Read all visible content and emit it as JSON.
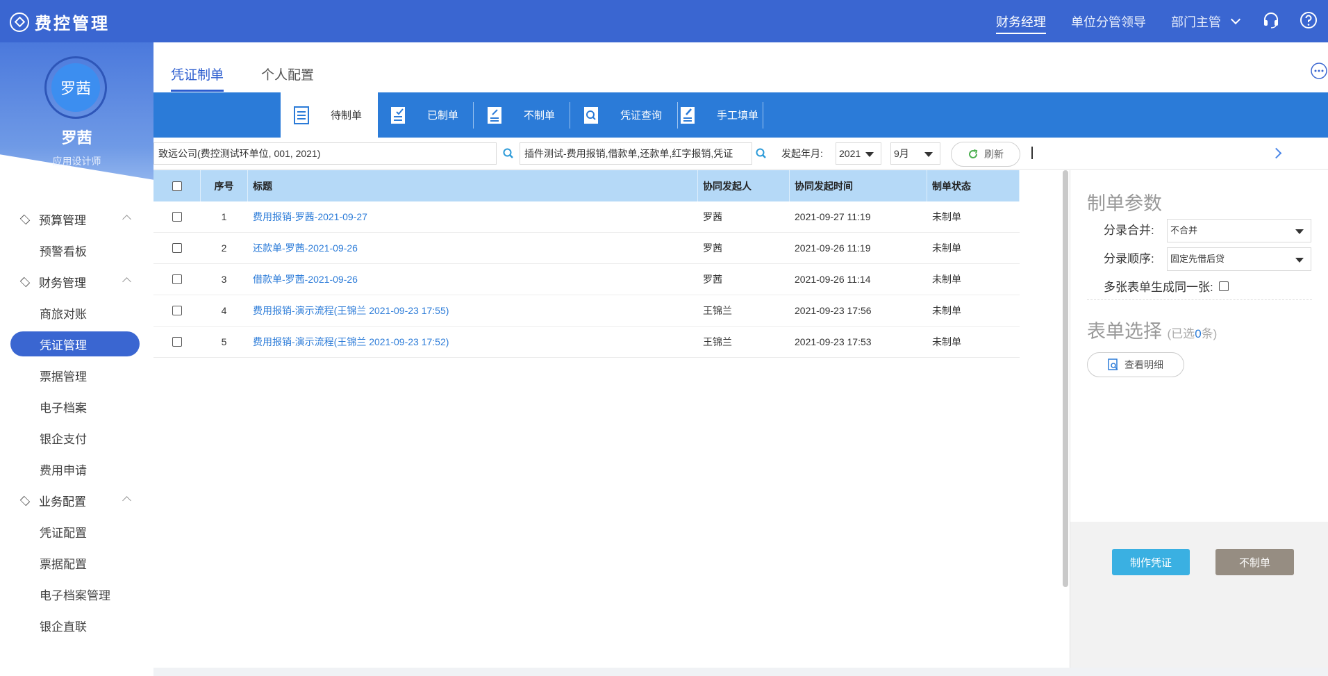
{
  "app": {
    "title": "费控管理"
  },
  "header": {
    "roles": [
      {
        "label": "财务经理",
        "active": true
      },
      {
        "label": "单位分管领导",
        "active": false
      },
      {
        "label": "部门主管",
        "active": false
      }
    ]
  },
  "profile": {
    "avatar_text": "罗茜",
    "name": "罗茜",
    "role": "应用设计师"
  },
  "sidebar": {
    "groups": [
      {
        "label": "预算管理",
        "items": [
          "预警看板"
        ]
      },
      {
        "label": "财务管理",
        "items": [
          "商旅对账",
          "凭证管理",
          "票据管理",
          "电子档案",
          "银企支付",
          "费用申请"
        ]
      },
      {
        "label": "业务配置",
        "items": [
          "凭证配置",
          "票据配置",
          "电子档案管理",
          "银企直联"
        ]
      }
    ],
    "active_item": "凭证管理"
  },
  "tabs": [
    {
      "label": "凭证制单",
      "active": true
    },
    {
      "label": "个人配置",
      "active": false
    }
  ],
  "toolbar": {
    "buttons": [
      "待制单",
      "已制单",
      "不制单",
      "凭证查询",
      "手工填单"
    ],
    "active": "待制单"
  },
  "filters": {
    "company": "致远公司(费控测试环单位, 001, 2021)",
    "templates": "插件测试-费用报销,借款单,还款单,红字报销,凭证",
    "year_month_label": "发起年月:",
    "year": "2021",
    "month": "9月",
    "refresh_label": "刷新"
  },
  "table": {
    "headers": [
      "序号",
      "标题",
      "协同发起人",
      "协同发起时间",
      "制单状态"
    ],
    "rows": [
      {
        "index": "1",
        "title": "费用报销-罗茜-2021-09-27",
        "initiator": "罗茜",
        "time": "2021-09-27 11:19",
        "status": "未制单"
      },
      {
        "index": "2",
        "title": "还款单-罗茜-2021-09-26",
        "initiator": "罗茜",
        "time": "2021-09-26 11:19",
        "status": "未制单"
      },
      {
        "index": "3",
        "title": "借款单-罗茜-2021-09-26",
        "initiator": "罗茜",
        "time": "2021-09-26 11:14",
        "status": "未制单"
      },
      {
        "index": "4",
        "title": "费用报销-演示流程(王锦兰 2021-09-23 17:55)",
        "initiator": "王锦兰",
        "time": "2021-09-23 17:56",
        "status": "未制单"
      },
      {
        "index": "5",
        "title": "费用报销-演示流程(王锦兰 2021-09-23 17:52)",
        "initiator": "王锦兰",
        "time": "2021-09-23 17:53",
        "status": "未制单"
      }
    ]
  },
  "panel": {
    "params_title": "制单参数",
    "merge_label": "分录合并:",
    "merge_value": "不合并",
    "order_label": "分录顺序:",
    "order_value": "固定先借后贷",
    "multi_label": "多张表单生成同一张:",
    "select_title": "表单选择",
    "selected_prefix": "(已选",
    "selected_count": "0",
    "selected_suffix": "条)",
    "detail_button": "查看明细",
    "make_button": "制作凭证",
    "skip_button": "不制单"
  },
  "colors": {
    "primary": "#3a66d1",
    "toolbar": "#2b7bd8",
    "table_header": "#b5d9f7",
    "make_button": "#3ab0e2",
    "skip_button": "#968d82"
  }
}
